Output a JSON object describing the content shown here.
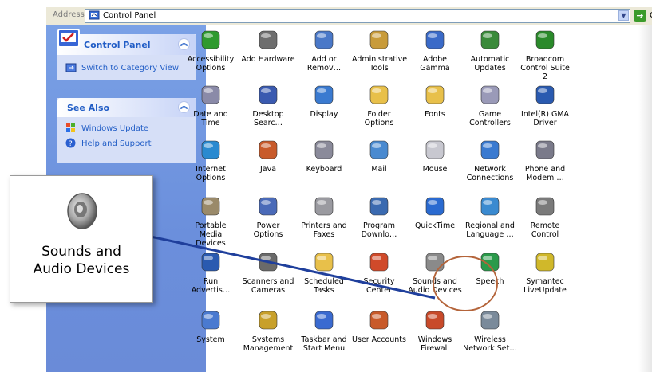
{
  "address_bar": {
    "label": "Address",
    "value": "Control Panel",
    "go_label": "Go"
  },
  "left_pane": {
    "control_panel": {
      "title": "Control Panel",
      "link": "Switch to Category View"
    },
    "see_also": {
      "title": "See Also",
      "links": [
        "Windows Update",
        "Help and Support"
      ]
    }
  },
  "icons": [
    {
      "label": "Accessibility\nOptions",
      "icon": "accessibility-icon"
    },
    {
      "label": "Add Hardware",
      "icon": "add-hardware-icon"
    },
    {
      "label": "Add or\nRemov…",
      "icon": "add-remove-programs-icon"
    },
    {
      "label": "Administrative\nTools",
      "icon": "administrative-tools-icon"
    },
    {
      "label": "Adobe Gamma",
      "icon": "adobe-gamma-icon"
    },
    {
      "label": "Automatic\nUpdates",
      "icon": "automatic-updates-icon"
    },
    {
      "label": "Broadcom\nControl Suite 2",
      "icon": "broadcom-icon"
    },
    {
      "label": "Date and Time",
      "icon": "date-time-icon"
    },
    {
      "label": "Desktop\nSearc…",
      "icon": "desktop-search-icon"
    },
    {
      "label": "Display",
      "icon": "display-icon"
    },
    {
      "label": "Folder Options",
      "icon": "folder-options-icon"
    },
    {
      "label": "Fonts",
      "icon": "fonts-icon"
    },
    {
      "label": "Game\nControllers",
      "icon": "game-controllers-icon"
    },
    {
      "label": "Intel(R) GMA\nDriver",
      "icon": "intel-gma-icon"
    },
    {
      "label": "Internet\nOptions",
      "icon": "internet-options-icon"
    },
    {
      "label": "Java",
      "icon": "java-icon"
    },
    {
      "label": "Keyboard",
      "icon": "keyboard-icon"
    },
    {
      "label": "Mail",
      "icon": "mail-icon"
    },
    {
      "label": "Mouse",
      "icon": "mouse-icon"
    },
    {
      "label": "Network\nConnections",
      "icon": "network-connections-icon"
    },
    {
      "label": "Phone and\nModem …",
      "icon": "phone-modem-icon"
    },
    {
      "label": "Portable Media\nDevices",
      "icon": "portable-media-icon"
    },
    {
      "label": "Power Options",
      "icon": "power-options-icon"
    },
    {
      "label": "Printers and\nFaxes",
      "icon": "printers-faxes-icon"
    },
    {
      "label": "Program\nDownlo…",
      "icon": "program-download-icon"
    },
    {
      "label": "QuickTime",
      "icon": "quicktime-icon"
    },
    {
      "label": "Regional and\nLanguage …",
      "icon": "regional-language-icon"
    },
    {
      "label": "Remote\nControl",
      "icon": "remote-control-icon"
    },
    {
      "label": "Run\nAdvertis…",
      "icon": "run-advertised-icon"
    },
    {
      "label": "Scanners and\nCameras",
      "icon": "scanners-cameras-icon"
    },
    {
      "label": "Scheduled\nTasks",
      "icon": "scheduled-tasks-icon"
    },
    {
      "label": "Security\nCenter",
      "icon": "security-center-icon"
    },
    {
      "label": "Sounds and\nAudio Devices",
      "icon": "sounds-audio-icon"
    },
    {
      "label": "Speech",
      "icon": "speech-icon"
    },
    {
      "label": "Symantec\nLiveUpdate",
      "icon": "symantec-liveupdate-icon"
    },
    {
      "label": "System",
      "icon": "system-icon"
    },
    {
      "label": "Systems\nManagement",
      "icon": "systems-management-icon"
    },
    {
      "label": "Taskbar and\nStart Menu",
      "icon": "taskbar-start-menu-icon"
    },
    {
      "label": "User Accounts",
      "icon": "user-accounts-icon"
    },
    {
      "label": "Windows\nFirewall",
      "icon": "windows-firewall-icon"
    },
    {
      "label": "Wireless\nNetwork Set…",
      "icon": "wireless-network-icon"
    }
  ],
  "callout": {
    "text": "Sounds and\nAudio Devices",
    "icon": "speaker-icon",
    "highlight_color": "#b4643a",
    "arrow_color": "#1f3f9c"
  }
}
